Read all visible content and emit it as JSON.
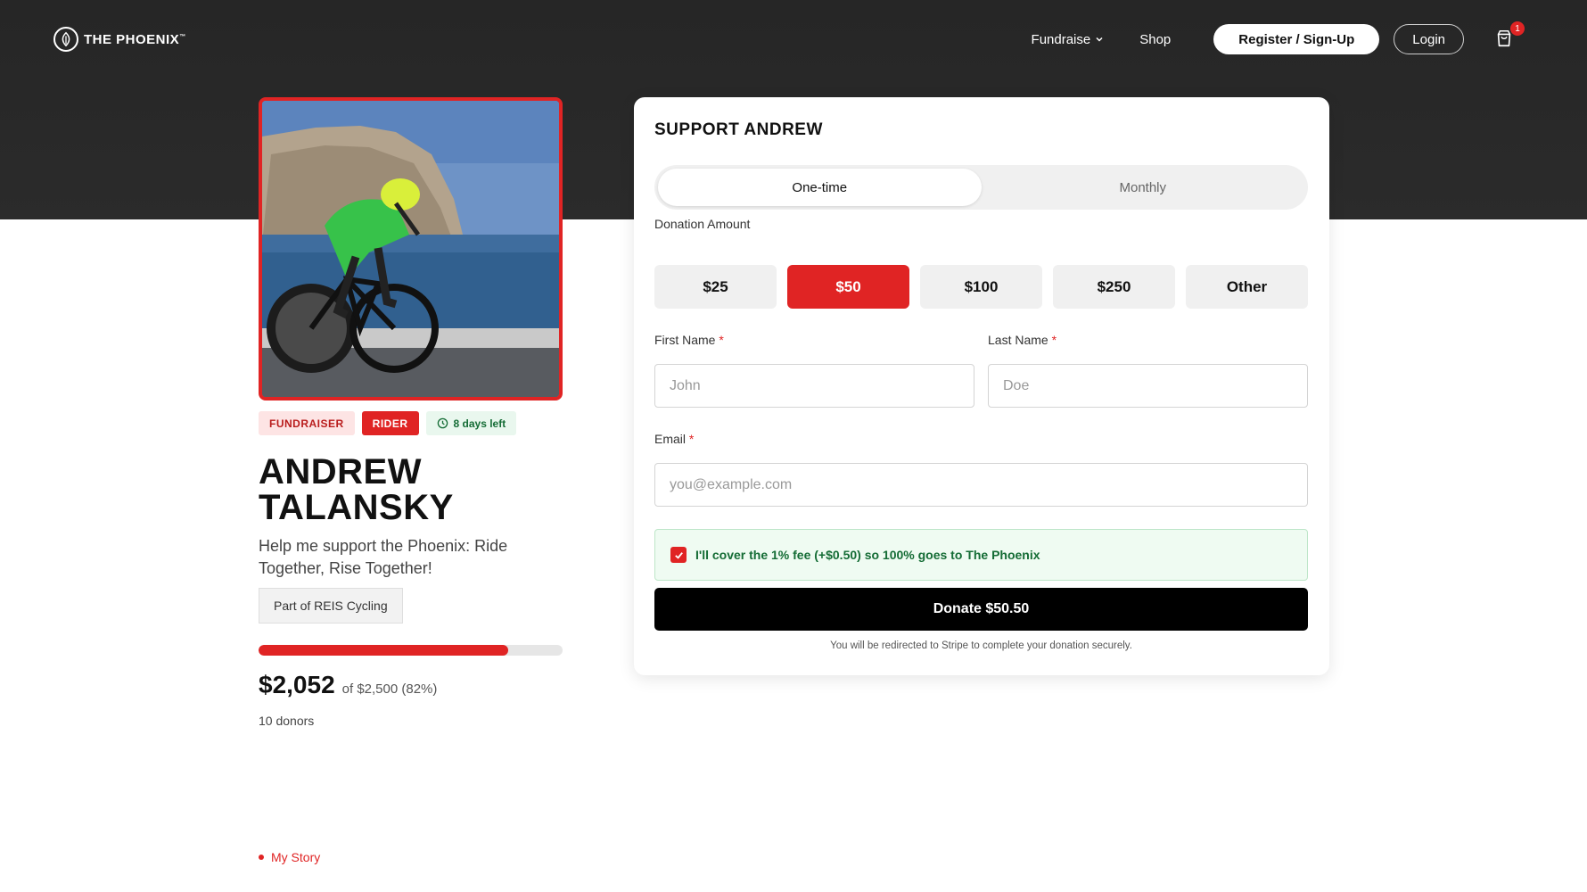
{
  "header": {
    "logo_text": "THE PHOENIX",
    "logo_tm": "™",
    "nav": {
      "fundraise": "Fundraise",
      "shop": "Shop"
    },
    "register_label": "Register / Sign-Up",
    "login_label": "Login",
    "cart_count": "1"
  },
  "fundraiser": {
    "badges": {
      "fundraiser": "FUNDRAISER",
      "rider": "RIDER",
      "days_left": "8 days left"
    },
    "name_line1": "ANDREW",
    "name_line2": "TALANSKY",
    "tagline": "Help me support the Phoenix: Ride Together, Rise Together!",
    "team": "Part of REIS Cycling",
    "raised": "$2,052",
    "goal_text": "of $2,500 (82%)",
    "progress_percent": 82,
    "donors": "10 donors",
    "story_link": "My Story"
  },
  "donation_form": {
    "title": "SUPPORT ANDREW",
    "frequency": {
      "one_time": "One-time",
      "monthly": "Monthly",
      "selected": "One-time"
    },
    "amount_label": "Donation Amount",
    "amounts": [
      "$25",
      "$50",
      "$100",
      "$250",
      "Other"
    ],
    "selected_amount": "$50",
    "first_name_label": "First Name",
    "first_name_placeholder": "John",
    "last_name_label": "Last Name",
    "last_name_placeholder": "Doe",
    "email_label": "Email",
    "email_placeholder": "you@example.com",
    "required_mark": "*",
    "cover_fee_text": "I'll cover the 1% fee (+$0.50) so 100% goes to The Phoenix",
    "cover_fee_checked": true,
    "donate_label": "Donate $50.50",
    "redirect_note": "You will be redirected to Stripe to complete your donation securely."
  },
  "colors": {
    "accent": "#e02424",
    "header_bg": "#2a2a2a",
    "success_bg": "#effbf2",
    "success_text": "#146c35"
  }
}
